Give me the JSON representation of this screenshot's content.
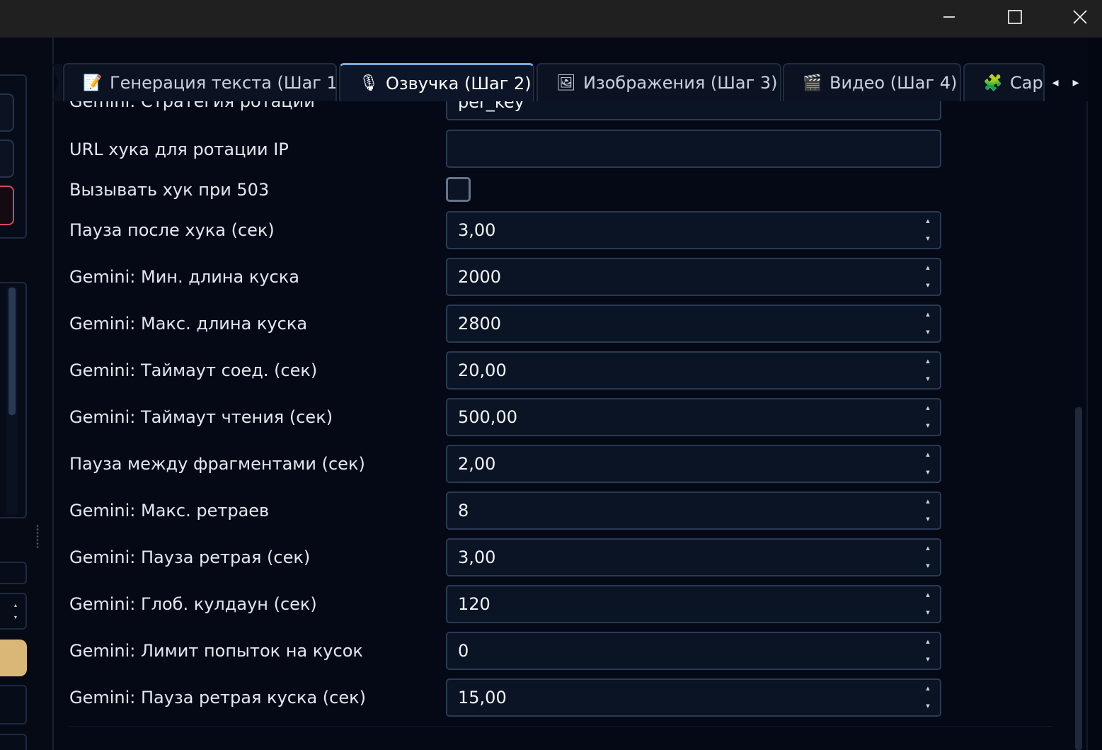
{
  "titlebar": {
    "minimize_icon": "minimize-icon",
    "maximize_icon": "maximize-icon",
    "close_icon": "close-icon"
  },
  "tabs": [
    {
      "icon": "📝",
      "label": "Генерация текста (Шаг 1)",
      "active": false
    },
    {
      "icon": "🎙",
      "label": "Озвучка (Шаг 2)",
      "active": true
    },
    {
      "icon": "🖼",
      "label": "Изображения (Шаг 3)",
      "active": false
    },
    {
      "icon": "🎬",
      "label": "Видео (Шаг 4)",
      "active": false
    },
    {
      "icon": "🧩",
      "label": "Cap",
      "active": false
    }
  ],
  "tab_scroll": {
    "left": "◂",
    "right": "▸"
  },
  "settings": {
    "clipped_label": "Gemini: Стратегия ротации",
    "clipped_value": "per_key",
    "url_hook_label": "URL хука для ротации IP",
    "url_hook_value": "",
    "call_hook_label": "Вызывать хук при 503",
    "call_hook_checked": false,
    "rows": [
      {
        "label": "Пауза после хука (сек)",
        "value": "3,00"
      },
      {
        "label": "Gemini: Мин. длина куска",
        "value": "2000"
      },
      {
        "label": "Gemini: Макс. длина куска",
        "value": "2800"
      },
      {
        "label": "Gemini: Таймаут соед. (сек)",
        "value": "20,00"
      },
      {
        "label": "Gemini: Таймаут чтения (сек)",
        "value": "500,00"
      },
      {
        "label": "Пауза между фрагментами (сек)",
        "value": "2,00"
      },
      {
        "label": "Gemini: Макс. ретраев",
        "value": "8"
      },
      {
        "label": "Gemini: Пауза ретрая (сек)",
        "value": "3,00"
      },
      {
        "label": "Gemini: Глоб. кулдаун (сек)",
        "value": "120"
      },
      {
        "label": "Gemini: Лимит попыток на кусок",
        "value": "0"
      },
      {
        "label": "Gemini: Пауза ретрая куска (сек)",
        "value": "15,00"
      }
    ]
  },
  "colors": {
    "background": "#040915",
    "field_bg": "#0b1424",
    "field_border": "#2a3a55",
    "active_tab_accent": "#7aa9e0",
    "danger_border": "#d9445a",
    "gold_button": "#d9b877"
  }
}
